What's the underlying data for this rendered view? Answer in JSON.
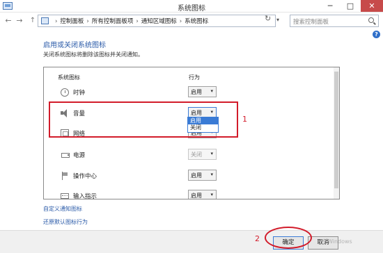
{
  "window": {
    "title": "系统图标",
    "minimize": "─",
    "maximize": "□",
    "close": "✕"
  },
  "nav": {
    "back": "←",
    "forward": "→",
    "up": "↑",
    "dropdown": "▾",
    "refresh": "↻"
  },
  "breadcrumbs": [
    "控制面板",
    "所有控制面板项",
    "通知区域图标",
    "系统图标"
  ],
  "breadcrumb_separator": "›",
  "search": {
    "placeholder": "搜索控制面板"
  },
  "help": "?",
  "page": {
    "title": "启用或关闭系统图标",
    "description": "关闭系统图标将删除该图标并关闭通知。"
  },
  "table": {
    "col_icon": "系统图标",
    "col_behavior": "行为",
    "rows": [
      {
        "label": "时钟",
        "value": "启用",
        "icon": "clock-icon",
        "disabled": false
      },
      {
        "label": "音量",
        "value": "启用",
        "icon": "speaker-icon",
        "disabled": false
      },
      {
        "label": "网络",
        "value": "启用",
        "icon": "network-icon",
        "disabled": false
      },
      {
        "label": "电源",
        "value": "关闭",
        "icon": "power-icon",
        "disabled": true
      },
      {
        "label": "操作中心",
        "value": "启用",
        "icon": "action-center-icon",
        "disabled": false
      },
      {
        "label": "输入指示",
        "value": "启用",
        "icon": "keyboard-icon",
        "disabled": false
      }
    ]
  },
  "dropdown": {
    "options": [
      "启用",
      "关闭"
    ],
    "highlighted": "启用"
  },
  "links": {
    "customize": "自定义通知图标",
    "restore": "还原默认图标行为"
  },
  "buttons": {
    "ok": "确定",
    "cancel": "取消"
  },
  "annotations": {
    "marker1": "1",
    "marker2": "2",
    "color": "#d21b2a"
  },
  "watermark": "Windows"
}
